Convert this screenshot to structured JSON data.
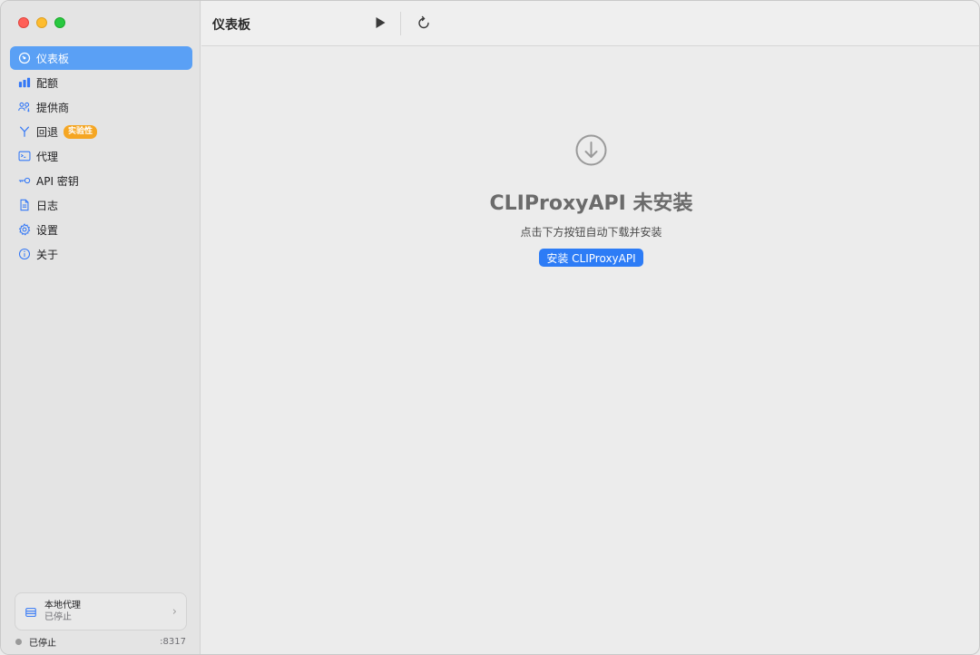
{
  "toolbar": {
    "title": "仪表板"
  },
  "sidebar": {
    "items": [
      {
        "label": "仪表板",
        "icon": "gauge-icon",
        "active": true
      },
      {
        "label": "配额",
        "icon": "bar-chart-icon"
      },
      {
        "label": "提供商",
        "icon": "people-icon"
      },
      {
        "label": "回退",
        "icon": "branch-icon",
        "badge": "实验性"
      },
      {
        "label": "代理",
        "icon": "terminal-icon"
      },
      {
        "label": "API 密钥",
        "icon": "key-icon"
      },
      {
        "label": "日志",
        "icon": "document-icon"
      },
      {
        "label": "设置",
        "icon": "gear-icon"
      },
      {
        "label": "关于",
        "icon": "info-icon"
      }
    ],
    "proxy_card": {
      "title": "本地代理",
      "status": "已停止"
    },
    "footer": {
      "status": "已停止",
      "port": ":8317"
    }
  },
  "main": {
    "title": "CLIProxyAPI 未安装",
    "subtitle": "点击下方按钮自动下载并安装",
    "install_button": "安装 CLIProxyAPI"
  },
  "colors": {
    "accent": "#2d7cf6",
    "active_item": "#5aa0f5",
    "badge": "#f5a623"
  }
}
